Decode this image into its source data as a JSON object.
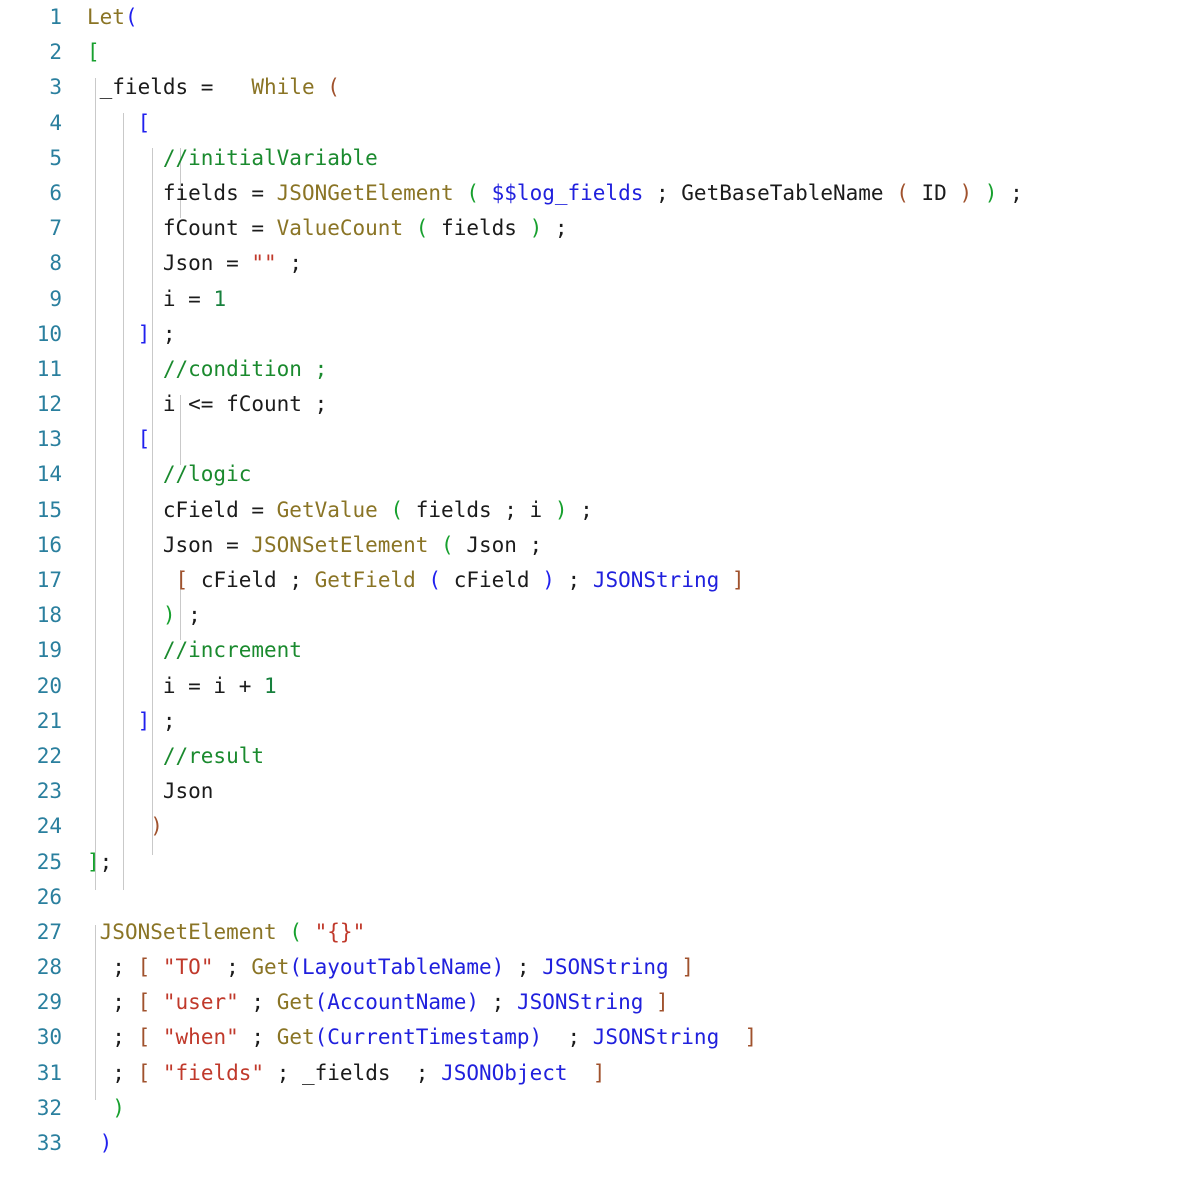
{
  "editor": {
    "name": "code-editor",
    "language": "FileMaker calculation",
    "background_color": "#ffffff",
    "gutter_color": "#2a7f9e",
    "indent_guide_color": "#c9c9c9",
    "total_lines": 33,
    "colors": {
      "plain": "#1b1b1b",
      "function": "#8a7425",
      "comment": "#1a8a2e",
      "string": "#c0392b",
      "number": "#17803d",
      "variable": "#2020dd",
      "paren_blue": "#2020ee",
      "paren_green": "#17a02e",
      "paren_brown": "#a0522d"
    }
  },
  "lines": [
    {
      "n": "1",
      "text": "Let("
    },
    {
      "n": "2",
      "text": "["
    },
    {
      "n": "3",
      "text": " _fields =   While ("
    },
    {
      "n": "4",
      "text": "    ["
    },
    {
      "n": "5",
      "text": "      //initialVariable"
    },
    {
      "n": "6",
      "text": "      fields = JSONGetElement ( $$log_fields ; GetBaseTableName ( ID ) ) ;"
    },
    {
      "n": "7",
      "text": "      fCount = ValueCount ( fields ) ;"
    },
    {
      "n": "8",
      "text": "      Json = \"\" ;"
    },
    {
      "n": "9",
      "text": "      i = 1"
    },
    {
      "n": "10",
      "text": "    ] ;"
    },
    {
      "n": "11",
      "text": "      //condition ;"
    },
    {
      "n": "12",
      "text": "      i <= fCount ;"
    },
    {
      "n": "13",
      "text": "    ["
    },
    {
      "n": "14",
      "text": "      //logic"
    },
    {
      "n": "15",
      "text": "      cField = GetValue ( fields ; i ) ;"
    },
    {
      "n": "16",
      "text": "      Json = JSONSetElement ( Json ;"
    },
    {
      "n": "17",
      "text": "       [ cField ; GetField ( cField ) ; JSONString ]"
    },
    {
      "n": "18",
      "text": "      ) ;"
    },
    {
      "n": "19",
      "text": "      //increment"
    },
    {
      "n": "20",
      "text": "      i = i + 1"
    },
    {
      "n": "21",
      "text": "    ] ;"
    },
    {
      "n": "22",
      "text": "      //result"
    },
    {
      "n": "23",
      "text": "      Json"
    },
    {
      "n": "24",
      "text": "     )"
    },
    {
      "n": "25",
      "text": "];"
    },
    {
      "n": "26",
      "text": ""
    },
    {
      "n": "27",
      "text": " JSONSetElement ( \"{}\""
    },
    {
      "n": "28",
      "text": "  ; [ \"TO\" ; Get(LayoutTableName) ; JSONString ]"
    },
    {
      "n": "29",
      "text": "  ; [ \"user\" ; Get(AccountName) ; JSONString ]"
    },
    {
      "n": "30",
      "text": "  ; [ \"when\" ; Get(CurrentTimestamp)  ; JSONString  ]"
    },
    {
      "n": "31",
      "text": "  ; [ \"fields\" ; _fields  ; JSONObject  ]"
    },
    {
      "n": "32",
      "text": "  )"
    },
    {
      "n": "33",
      "text": " )"
    }
  ]
}
